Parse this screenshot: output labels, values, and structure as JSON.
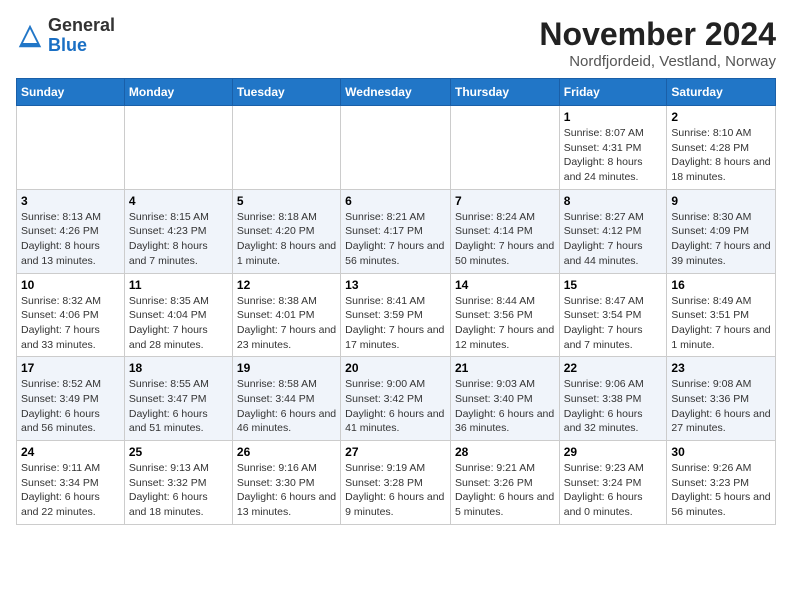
{
  "header": {
    "logo_general": "General",
    "logo_blue": "Blue",
    "month_title": "November 2024",
    "location": "Nordfjordeid, Vestland, Norway"
  },
  "weekdays": [
    "Sunday",
    "Monday",
    "Tuesday",
    "Wednesday",
    "Thursday",
    "Friday",
    "Saturday"
  ],
  "weeks": [
    [
      {
        "day": "",
        "info": ""
      },
      {
        "day": "",
        "info": ""
      },
      {
        "day": "",
        "info": ""
      },
      {
        "day": "",
        "info": ""
      },
      {
        "day": "",
        "info": ""
      },
      {
        "day": "1",
        "info": "Sunrise: 8:07 AM\nSunset: 4:31 PM\nDaylight: 8 hours and 24 minutes."
      },
      {
        "day": "2",
        "info": "Sunrise: 8:10 AM\nSunset: 4:28 PM\nDaylight: 8 hours and 18 minutes."
      }
    ],
    [
      {
        "day": "3",
        "info": "Sunrise: 8:13 AM\nSunset: 4:26 PM\nDaylight: 8 hours and 13 minutes."
      },
      {
        "day": "4",
        "info": "Sunrise: 8:15 AM\nSunset: 4:23 PM\nDaylight: 8 hours and 7 minutes."
      },
      {
        "day": "5",
        "info": "Sunrise: 8:18 AM\nSunset: 4:20 PM\nDaylight: 8 hours and 1 minute."
      },
      {
        "day": "6",
        "info": "Sunrise: 8:21 AM\nSunset: 4:17 PM\nDaylight: 7 hours and 56 minutes."
      },
      {
        "day": "7",
        "info": "Sunrise: 8:24 AM\nSunset: 4:14 PM\nDaylight: 7 hours and 50 minutes."
      },
      {
        "day": "8",
        "info": "Sunrise: 8:27 AM\nSunset: 4:12 PM\nDaylight: 7 hours and 44 minutes."
      },
      {
        "day": "9",
        "info": "Sunrise: 8:30 AM\nSunset: 4:09 PM\nDaylight: 7 hours and 39 minutes."
      }
    ],
    [
      {
        "day": "10",
        "info": "Sunrise: 8:32 AM\nSunset: 4:06 PM\nDaylight: 7 hours and 33 minutes."
      },
      {
        "day": "11",
        "info": "Sunrise: 8:35 AM\nSunset: 4:04 PM\nDaylight: 7 hours and 28 minutes."
      },
      {
        "day": "12",
        "info": "Sunrise: 8:38 AM\nSunset: 4:01 PM\nDaylight: 7 hours and 23 minutes."
      },
      {
        "day": "13",
        "info": "Sunrise: 8:41 AM\nSunset: 3:59 PM\nDaylight: 7 hours and 17 minutes."
      },
      {
        "day": "14",
        "info": "Sunrise: 8:44 AM\nSunset: 3:56 PM\nDaylight: 7 hours and 12 minutes."
      },
      {
        "day": "15",
        "info": "Sunrise: 8:47 AM\nSunset: 3:54 PM\nDaylight: 7 hours and 7 minutes."
      },
      {
        "day": "16",
        "info": "Sunrise: 8:49 AM\nSunset: 3:51 PM\nDaylight: 7 hours and 1 minute."
      }
    ],
    [
      {
        "day": "17",
        "info": "Sunrise: 8:52 AM\nSunset: 3:49 PM\nDaylight: 6 hours and 56 minutes."
      },
      {
        "day": "18",
        "info": "Sunrise: 8:55 AM\nSunset: 3:47 PM\nDaylight: 6 hours and 51 minutes."
      },
      {
        "day": "19",
        "info": "Sunrise: 8:58 AM\nSunset: 3:44 PM\nDaylight: 6 hours and 46 minutes."
      },
      {
        "day": "20",
        "info": "Sunrise: 9:00 AM\nSunset: 3:42 PM\nDaylight: 6 hours and 41 minutes."
      },
      {
        "day": "21",
        "info": "Sunrise: 9:03 AM\nSunset: 3:40 PM\nDaylight: 6 hours and 36 minutes."
      },
      {
        "day": "22",
        "info": "Sunrise: 9:06 AM\nSunset: 3:38 PM\nDaylight: 6 hours and 32 minutes."
      },
      {
        "day": "23",
        "info": "Sunrise: 9:08 AM\nSunset: 3:36 PM\nDaylight: 6 hours and 27 minutes."
      }
    ],
    [
      {
        "day": "24",
        "info": "Sunrise: 9:11 AM\nSunset: 3:34 PM\nDaylight: 6 hours and 22 minutes."
      },
      {
        "day": "25",
        "info": "Sunrise: 9:13 AM\nSunset: 3:32 PM\nDaylight: 6 hours and 18 minutes."
      },
      {
        "day": "26",
        "info": "Sunrise: 9:16 AM\nSunset: 3:30 PM\nDaylight: 6 hours and 13 minutes."
      },
      {
        "day": "27",
        "info": "Sunrise: 9:19 AM\nSunset: 3:28 PM\nDaylight: 6 hours and 9 minutes."
      },
      {
        "day": "28",
        "info": "Sunrise: 9:21 AM\nSunset: 3:26 PM\nDaylight: 6 hours and 5 minutes."
      },
      {
        "day": "29",
        "info": "Sunrise: 9:23 AM\nSunset: 3:24 PM\nDaylight: 6 hours and 0 minutes."
      },
      {
        "day": "30",
        "info": "Sunrise: 9:26 AM\nSunset: 3:23 PM\nDaylight: 5 hours and 56 minutes."
      }
    ]
  ]
}
